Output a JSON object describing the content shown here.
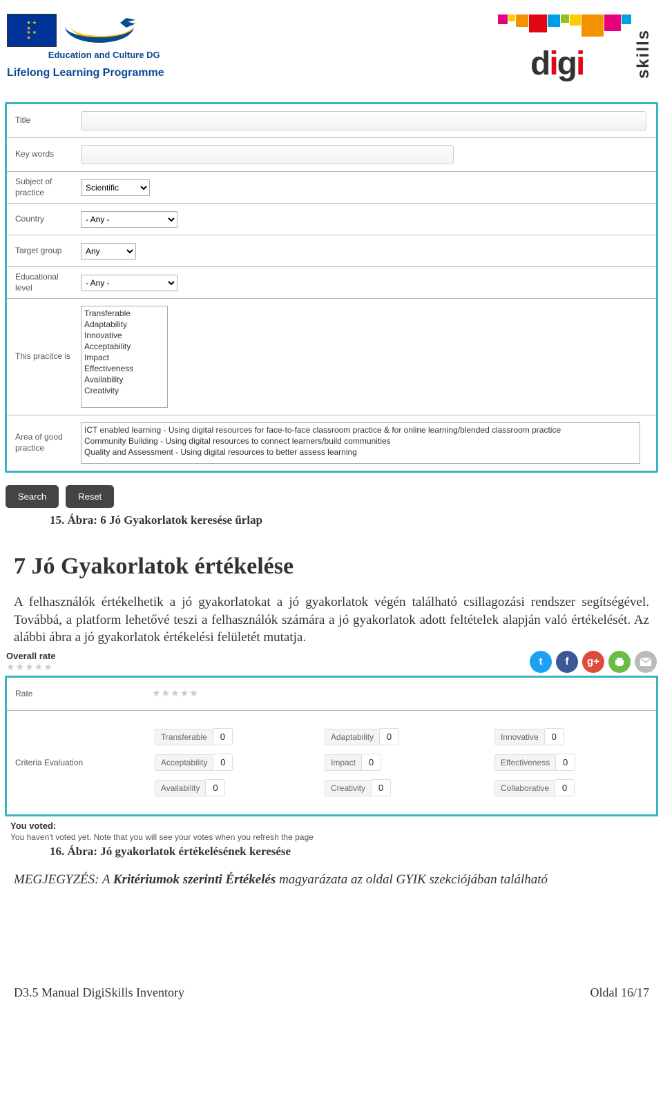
{
  "header": {
    "edu_text": "Education and Culture DG",
    "llp": "Lifelong Learning Programme",
    "digi": "digi",
    "skills": "skills"
  },
  "form": {
    "title_label": "Title",
    "keywords_label": "Key words",
    "subject_label": "Subject of practice",
    "subject_value": "Scientific",
    "country_label": "Country",
    "country_value": "- Any -",
    "target_label": "Target group",
    "target_value": "Any",
    "edulevel_label": "Educational level",
    "edulevel_value": "- Any -",
    "practice_label": "This pracitce is",
    "practice_options": [
      "Transferable",
      "Adaptability",
      "Innovative",
      "Acceptability",
      "Impact",
      "Effectiveness",
      "Availability",
      "Creativity"
    ],
    "area_label": "Area of good practice",
    "area_options": [
      "ICT enabled learning - Using digital resources for face-to-face classroom practice & for online learning/blended classroom practice",
      "Community Building - Using digital resources to connect learners/build communities",
      "Quality and Assessment - Using digital resources to better assess learning"
    ],
    "search_btn": "Search",
    "reset_btn": "Reset"
  },
  "caption1": "15. Ábra: 6 Jó Gyakorlatok keresése űrlap",
  "section_title": "7  Jó Gyakorlatok értékelése",
  "para": "A felhasználók értékelhetik a jó gyakorlatokat a jó gyakorlatok végén található csillagozási rendszer segítségével. Továbbá, a platform lehetővé teszi a felhasználók számára a jó gyakorlatok adott feltételek alapján való értékelését. Az alábbi ábra a jó gyakorlatok értékelési felületét mutatja.",
  "rating": {
    "overall_label": "Overall rate",
    "rate_label": "Rate",
    "criteria_label": "Criteria Evaluation",
    "criteria": [
      {
        "name": "Transferable",
        "val": "0"
      },
      {
        "name": "Adaptability",
        "val": "0"
      },
      {
        "name": "Innovative",
        "val": "0"
      },
      {
        "name": "Acceptability",
        "val": "0"
      },
      {
        "name": "Impact",
        "val": "0"
      },
      {
        "name": "Effectiveness",
        "val": "0"
      },
      {
        "name": "Availability",
        "val": "0"
      },
      {
        "name": "Creativity",
        "val": "0"
      },
      {
        "name": "Collaborative",
        "val": "0"
      }
    ],
    "voted_h": "You voted:",
    "voted_note": "You haven't voted yet. Note that you will see your votes when you refresh the page"
  },
  "caption2": "16. Ábra: Jó gyakorlatok értékelésének keresése",
  "note_lead": "MEGJEGYZÉS: A ",
  "note_em": "Kritériumok szerinti Értékelés",
  "note_tail": " magyarázata az oldal GYIK szekciójában található",
  "footer_left": "D3.5 Manual DigiSkills Inventory",
  "footer_right": "Oldal 16/17"
}
